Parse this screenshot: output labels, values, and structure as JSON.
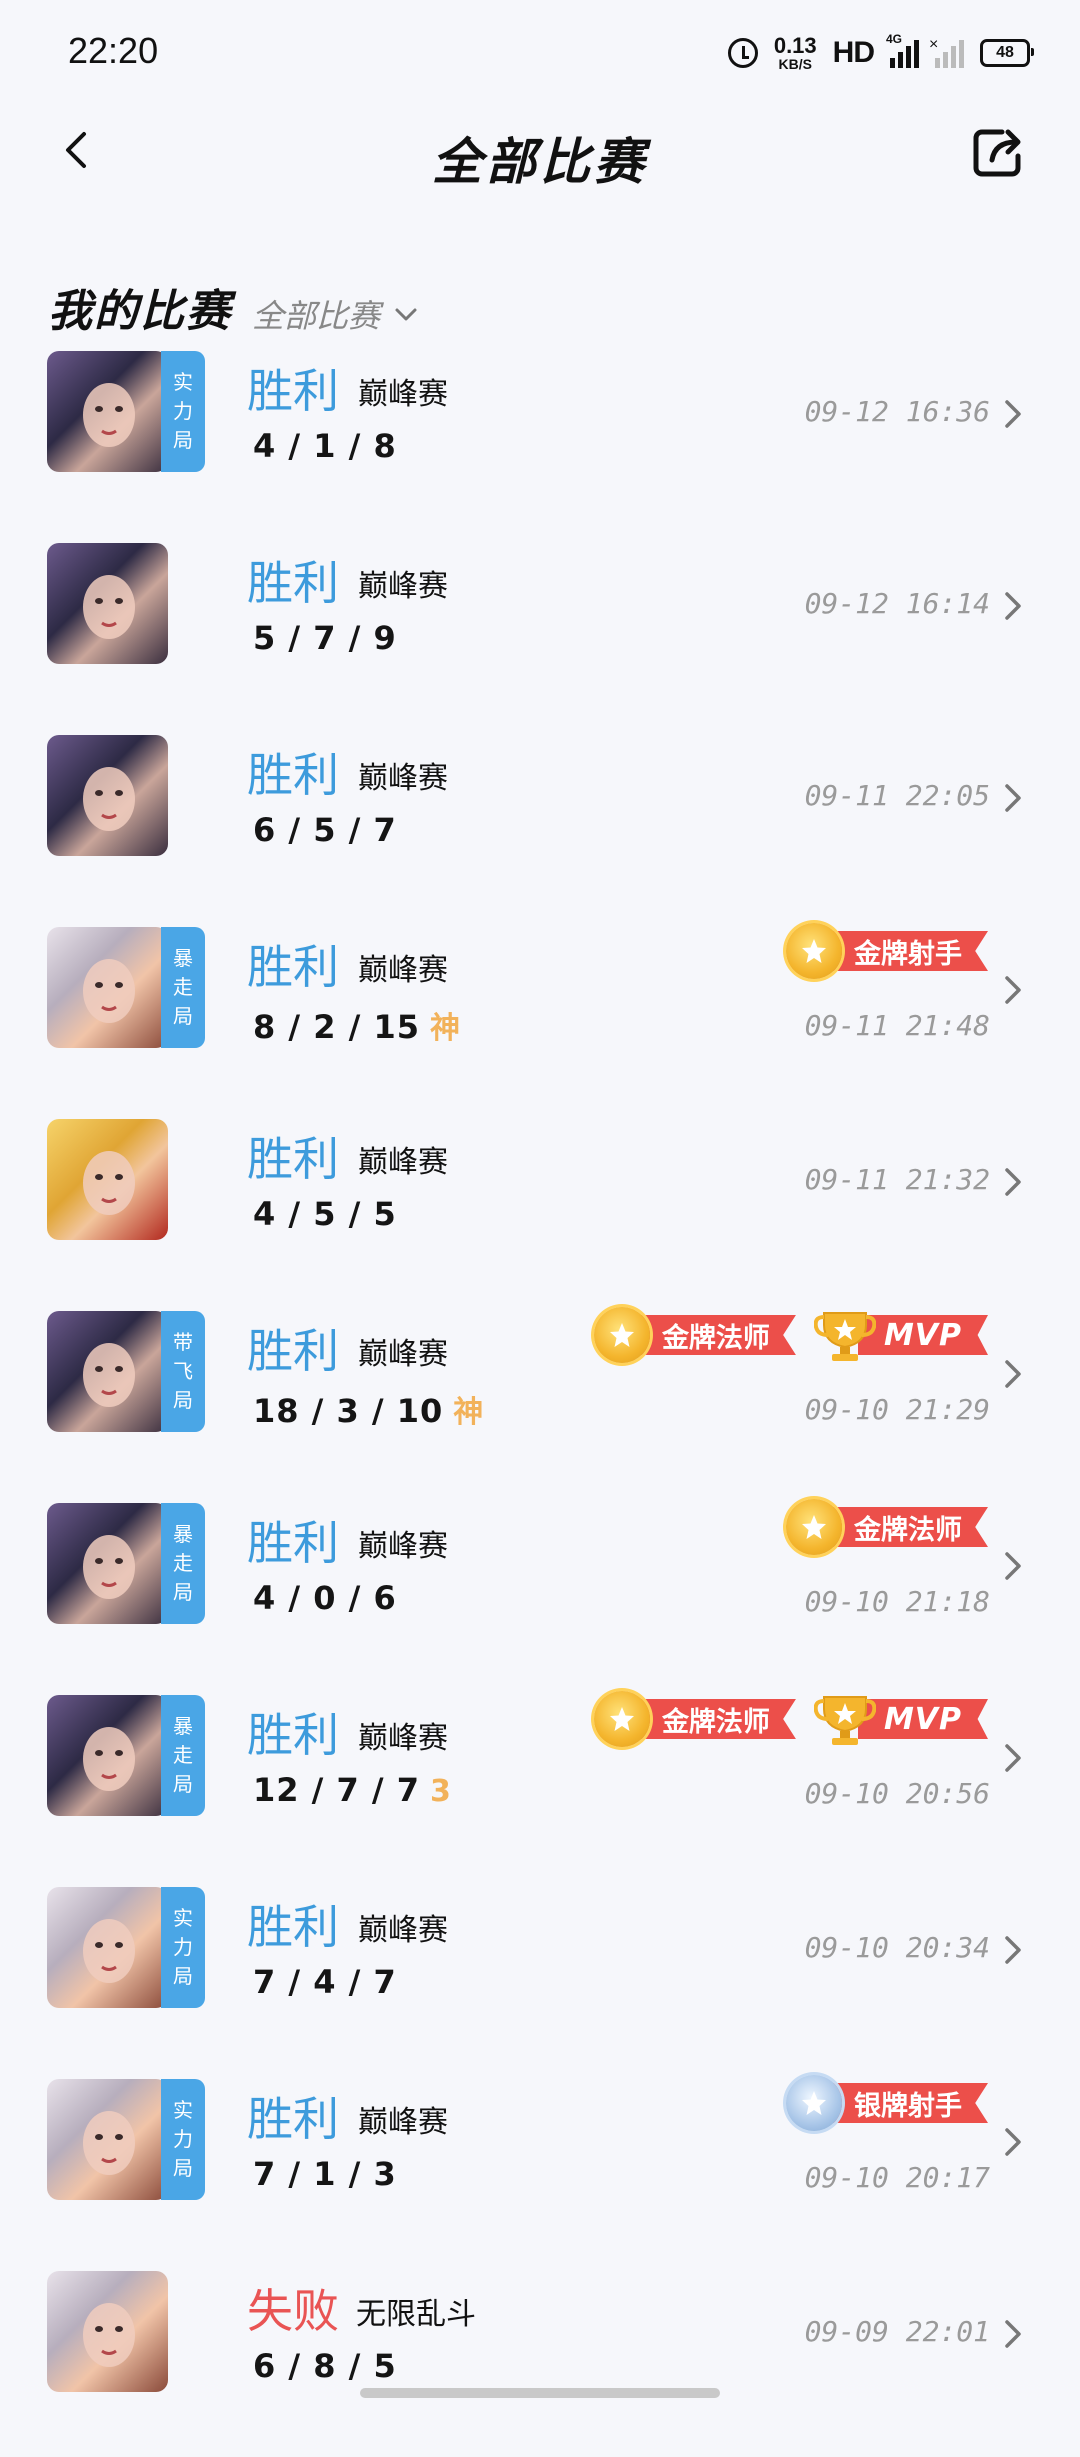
{
  "status_bar": {
    "time": "22:20",
    "net_speed": "0.13",
    "net_unit": "KB/S",
    "hd": "HD",
    "network": "4G",
    "battery": "48"
  },
  "header": {
    "title": "全部比赛"
  },
  "section": {
    "title": "我的比赛",
    "filter": "全部比赛"
  },
  "matches": [
    {
      "result": "胜利",
      "mode": "巅峰赛",
      "kda": "4 / 1 / 8",
      "kda_badge": "",
      "time": "09-12 16:36",
      "tag": "实力局",
      "badges": []
    },
    {
      "result": "胜利",
      "mode": "巅峰赛",
      "kda": "5 / 7 / 9",
      "kda_badge": "",
      "time": "09-12 16:14",
      "tag": "",
      "badges": []
    },
    {
      "result": "胜利",
      "mode": "巅峰赛",
      "kda": "6 / 5 / 7",
      "kda_badge": "",
      "time": "09-11 22:05",
      "tag": "",
      "badges": []
    },
    {
      "result": "胜利",
      "mode": "巅峰赛",
      "kda": "8 / 2 / 15",
      "kda_badge": "神",
      "time": "09-11 21:48",
      "tag": "暴走局",
      "badges": [
        "金牌射手"
      ]
    },
    {
      "result": "胜利",
      "mode": "巅峰赛",
      "kda": "4 / 5 / 5",
      "kda_badge": "",
      "time": "09-11 21:32",
      "tag": "",
      "badges": []
    },
    {
      "result": "胜利",
      "mode": "巅峰赛",
      "kda": "18 / 3 / 10",
      "kda_badge": "神",
      "time": "09-10 21:29",
      "tag": "带飞局",
      "badges": [
        "金牌法师",
        "MVP"
      ]
    },
    {
      "result": "胜利",
      "mode": "巅峰赛",
      "kda": "4 / 0 / 6",
      "kda_badge": "",
      "time": "09-10 21:18",
      "tag": "暴走局",
      "badges": [
        "金牌法师"
      ]
    },
    {
      "result": "胜利",
      "mode": "巅峰赛",
      "kda": "12 / 7 / 7",
      "kda_badge": "3",
      "time": "09-10 20:56",
      "tag": "暴走局",
      "badges": [
        "金牌法师",
        "MVP"
      ]
    },
    {
      "result": "胜利",
      "mode": "巅峰赛",
      "kda": "7 / 4 / 7",
      "kda_badge": "",
      "time": "09-10 20:34",
      "tag": "实力局",
      "badges": []
    },
    {
      "result": "胜利",
      "mode": "巅峰赛",
      "kda": "7 / 1 / 3",
      "kda_badge": "",
      "time": "09-10 20:17",
      "tag": "实力局",
      "badges": [
        "银牌射手"
      ]
    },
    {
      "result": "失败",
      "mode": "无限乱斗",
      "kda": "6 / 8 / 5",
      "kda_badge": "",
      "time": "09-09 22:01",
      "tag": "",
      "badges": []
    }
  ],
  "colors": {
    "win": "#3d9bdc",
    "lose": "#e95454",
    "tag": "#4aa6e6",
    "badge_ribbon": "#ec4f4a"
  }
}
